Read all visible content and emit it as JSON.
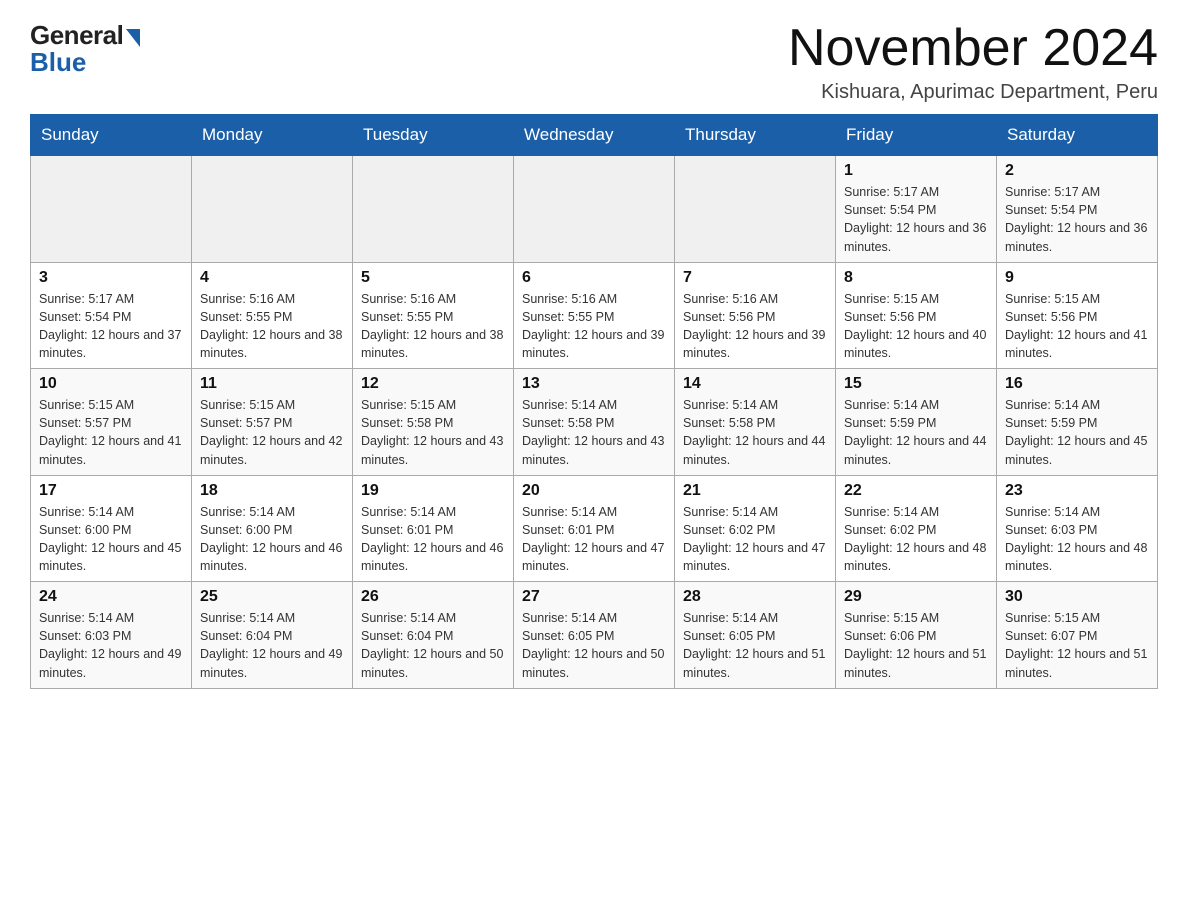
{
  "logo": {
    "general": "General",
    "blue": "Blue"
  },
  "title": "November 2024",
  "subtitle": "Kishuara, Apurimac Department, Peru",
  "days_of_week": [
    "Sunday",
    "Monday",
    "Tuesday",
    "Wednesday",
    "Thursday",
    "Friday",
    "Saturday"
  ],
  "weeks": [
    [
      {
        "day": "",
        "info": ""
      },
      {
        "day": "",
        "info": ""
      },
      {
        "day": "",
        "info": ""
      },
      {
        "day": "",
        "info": ""
      },
      {
        "day": "",
        "info": ""
      },
      {
        "day": "1",
        "info": "Sunrise: 5:17 AM\nSunset: 5:54 PM\nDaylight: 12 hours and 36 minutes."
      },
      {
        "day": "2",
        "info": "Sunrise: 5:17 AM\nSunset: 5:54 PM\nDaylight: 12 hours and 36 minutes."
      }
    ],
    [
      {
        "day": "3",
        "info": "Sunrise: 5:17 AM\nSunset: 5:54 PM\nDaylight: 12 hours and 37 minutes."
      },
      {
        "day": "4",
        "info": "Sunrise: 5:16 AM\nSunset: 5:55 PM\nDaylight: 12 hours and 38 minutes."
      },
      {
        "day": "5",
        "info": "Sunrise: 5:16 AM\nSunset: 5:55 PM\nDaylight: 12 hours and 38 minutes."
      },
      {
        "day": "6",
        "info": "Sunrise: 5:16 AM\nSunset: 5:55 PM\nDaylight: 12 hours and 39 minutes."
      },
      {
        "day": "7",
        "info": "Sunrise: 5:16 AM\nSunset: 5:56 PM\nDaylight: 12 hours and 39 minutes."
      },
      {
        "day": "8",
        "info": "Sunrise: 5:15 AM\nSunset: 5:56 PM\nDaylight: 12 hours and 40 minutes."
      },
      {
        "day": "9",
        "info": "Sunrise: 5:15 AM\nSunset: 5:56 PM\nDaylight: 12 hours and 41 minutes."
      }
    ],
    [
      {
        "day": "10",
        "info": "Sunrise: 5:15 AM\nSunset: 5:57 PM\nDaylight: 12 hours and 41 minutes."
      },
      {
        "day": "11",
        "info": "Sunrise: 5:15 AM\nSunset: 5:57 PM\nDaylight: 12 hours and 42 minutes."
      },
      {
        "day": "12",
        "info": "Sunrise: 5:15 AM\nSunset: 5:58 PM\nDaylight: 12 hours and 43 minutes."
      },
      {
        "day": "13",
        "info": "Sunrise: 5:14 AM\nSunset: 5:58 PM\nDaylight: 12 hours and 43 minutes."
      },
      {
        "day": "14",
        "info": "Sunrise: 5:14 AM\nSunset: 5:58 PM\nDaylight: 12 hours and 44 minutes."
      },
      {
        "day": "15",
        "info": "Sunrise: 5:14 AM\nSunset: 5:59 PM\nDaylight: 12 hours and 44 minutes."
      },
      {
        "day": "16",
        "info": "Sunrise: 5:14 AM\nSunset: 5:59 PM\nDaylight: 12 hours and 45 minutes."
      }
    ],
    [
      {
        "day": "17",
        "info": "Sunrise: 5:14 AM\nSunset: 6:00 PM\nDaylight: 12 hours and 45 minutes."
      },
      {
        "day": "18",
        "info": "Sunrise: 5:14 AM\nSunset: 6:00 PM\nDaylight: 12 hours and 46 minutes."
      },
      {
        "day": "19",
        "info": "Sunrise: 5:14 AM\nSunset: 6:01 PM\nDaylight: 12 hours and 46 minutes."
      },
      {
        "day": "20",
        "info": "Sunrise: 5:14 AM\nSunset: 6:01 PM\nDaylight: 12 hours and 47 minutes."
      },
      {
        "day": "21",
        "info": "Sunrise: 5:14 AM\nSunset: 6:02 PM\nDaylight: 12 hours and 47 minutes."
      },
      {
        "day": "22",
        "info": "Sunrise: 5:14 AM\nSunset: 6:02 PM\nDaylight: 12 hours and 48 minutes."
      },
      {
        "day": "23",
        "info": "Sunrise: 5:14 AM\nSunset: 6:03 PM\nDaylight: 12 hours and 48 minutes."
      }
    ],
    [
      {
        "day": "24",
        "info": "Sunrise: 5:14 AM\nSunset: 6:03 PM\nDaylight: 12 hours and 49 minutes."
      },
      {
        "day": "25",
        "info": "Sunrise: 5:14 AM\nSunset: 6:04 PM\nDaylight: 12 hours and 49 minutes."
      },
      {
        "day": "26",
        "info": "Sunrise: 5:14 AM\nSunset: 6:04 PM\nDaylight: 12 hours and 50 minutes."
      },
      {
        "day": "27",
        "info": "Sunrise: 5:14 AM\nSunset: 6:05 PM\nDaylight: 12 hours and 50 minutes."
      },
      {
        "day": "28",
        "info": "Sunrise: 5:14 AM\nSunset: 6:05 PM\nDaylight: 12 hours and 51 minutes."
      },
      {
        "day": "29",
        "info": "Sunrise: 5:15 AM\nSunset: 6:06 PM\nDaylight: 12 hours and 51 minutes."
      },
      {
        "day": "30",
        "info": "Sunrise: 5:15 AM\nSunset: 6:07 PM\nDaylight: 12 hours and 51 minutes."
      }
    ]
  ]
}
